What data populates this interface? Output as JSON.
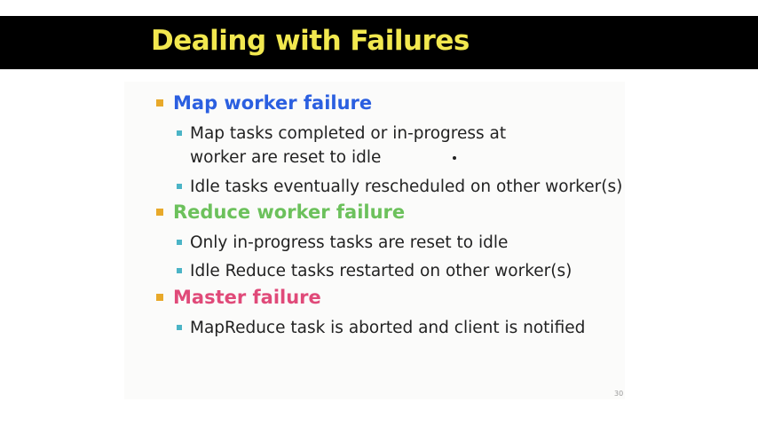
{
  "slide": {
    "title": "Dealing with Failures",
    "slide_number": "30"
  },
  "colors": {
    "title": "#f2e84f",
    "title_bar": "#000000",
    "map_worker": "#2b5fe0",
    "reduce_worker": "#6cc15c",
    "master": "#e04a79",
    "level1_bullet": "#e8a92a",
    "level2_bullet": "#4bb4c6"
  },
  "sections": [
    {
      "heading": "Map worker failure",
      "items": [
        "Map tasks completed or in-progress at",
        "worker are reset to idle",
        "Idle tasks eventually rescheduled on other worker(s)"
      ]
    },
    {
      "heading": "Reduce worker failure",
      "items": [
        "Only in-progress tasks are reset to idle",
        "Idle Reduce tasks restarted on other worker(s)"
      ]
    },
    {
      "heading": "Master failure",
      "items": [
        "MapReduce task is aborted and client is notified"
      ]
    }
  ]
}
